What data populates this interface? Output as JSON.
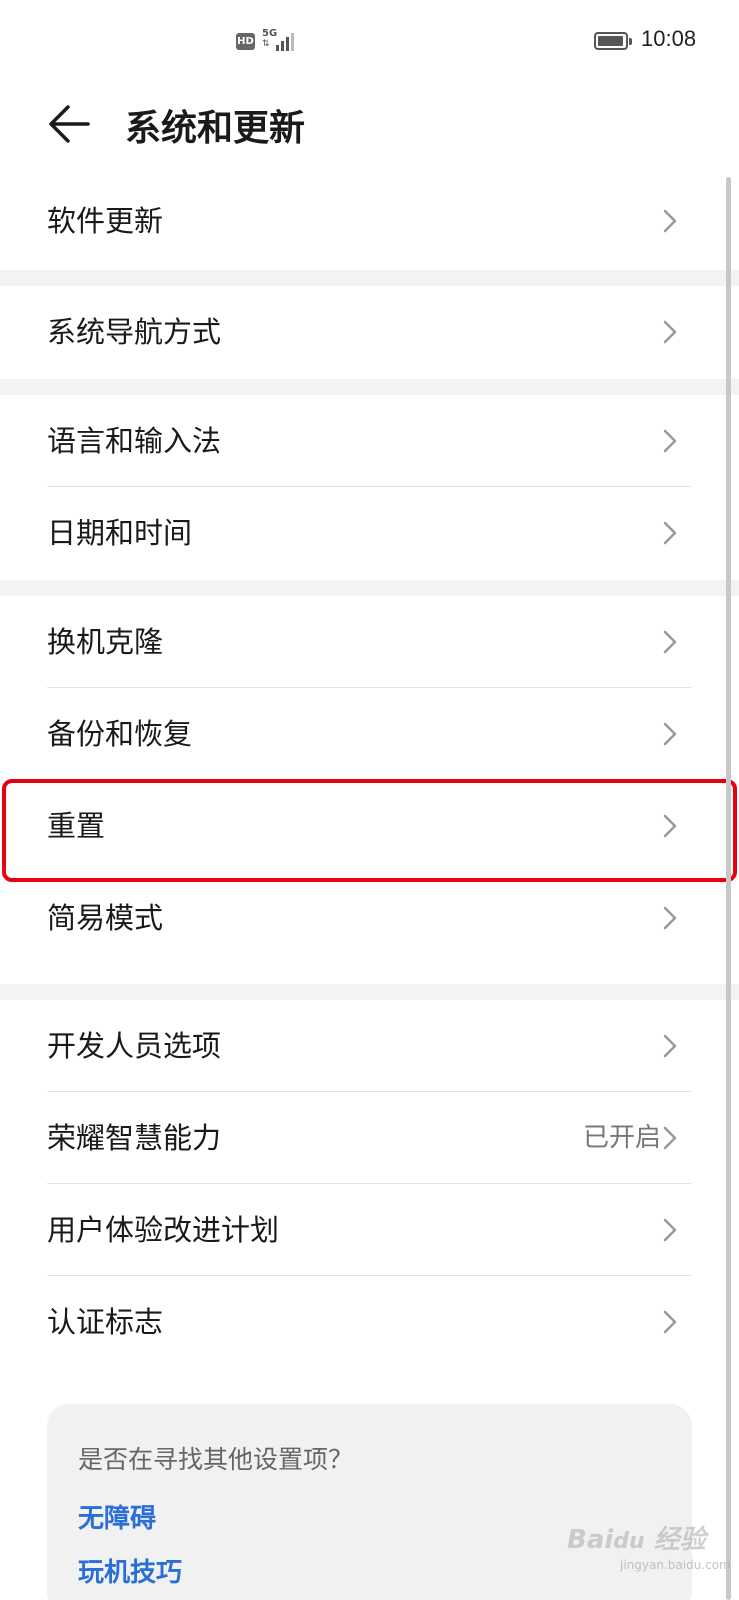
{
  "status_bar": {
    "hd": "HD",
    "network": "5G",
    "data_arrows": "⇅",
    "battery_level": 0.95,
    "time": "10:08"
  },
  "header": {
    "back_icon": "arrow-left-icon",
    "title": "系统和更新"
  },
  "groups": [
    {
      "items": [
        {
          "label": "软件更新"
        }
      ]
    },
    {
      "items": [
        {
          "label": "系统导航方式"
        }
      ]
    },
    {
      "items": [
        {
          "label": "语言和输入法"
        },
        {
          "label": "日期和时间"
        }
      ]
    },
    {
      "items": [
        {
          "label": "换机克隆"
        },
        {
          "label": "备份和恢复"
        },
        {
          "label": "重置"
        },
        {
          "label": "简易模式"
        }
      ]
    },
    {
      "items": [
        {
          "label": "开发人员选项"
        },
        {
          "label": "荣耀智慧能力",
          "value": "已开启"
        },
        {
          "label": "用户体验改进计划"
        },
        {
          "label": "认证标志"
        }
      ]
    }
  ],
  "highlight": {
    "target": "重置",
    "color": "#e60012"
  },
  "suggestion": {
    "title": "是否在寻找其他设置项？",
    "links": [
      "无障碍",
      "玩机技巧"
    ]
  },
  "colors": {
    "accent_link": "#2a6fd6",
    "separator": "#f1f3f5"
  },
  "watermark": {
    "text": "Bai du 经验",
    "sub": "jingyan.baidu.com"
  }
}
